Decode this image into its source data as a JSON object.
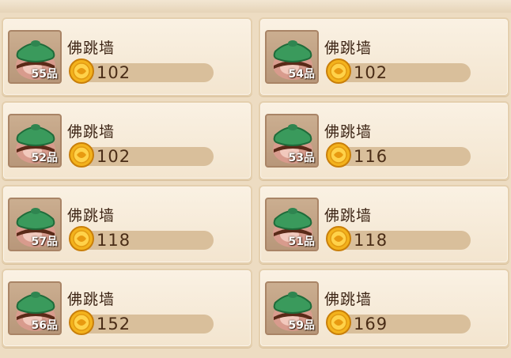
{
  "items": [
    {
      "name": "佛跳墙",
      "quality": "55品",
      "price": "102"
    },
    {
      "name": "佛跳墙",
      "quality": "54品",
      "price": "102"
    },
    {
      "name": "佛跳墙",
      "quality": "52品",
      "price": "102"
    },
    {
      "name": "佛跳墙",
      "quality": "53品",
      "price": "116"
    },
    {
      "name": "佛跳墙",
      "quality": "57品",
      "price": "118"
    },
    {
      "name": "佛跳墙",
      "quality": "51品",
      "price": "118"
    },
    {
      "name": "佛跳墙",
      "quality": "56品",
      "price": "152"
    },
    {
      "name": "佛跳墙",
      "quality": "59品",
      "price": "169"
    }
  ],
  "icons": {
    "item": "clay-pot-icon",
    "currency": "gold-coin-icon"
  },
  "colors": {
    "card_bg": "#f6ead8",
    "price_bar": "#d9bf9b",
    "pot_lid": "#3a9a5c",
    "coin": "#f3b21c"
  }
}
